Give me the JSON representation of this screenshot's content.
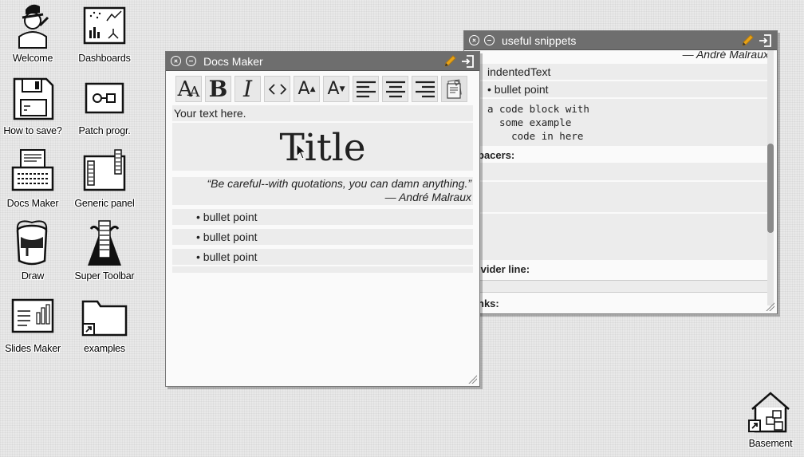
{
  "desktop": {
    "icons": [
      {
        "label": "Welcome",
        "icon": "welcome-person-icon"
      },
      {
        "label": "Dashboards",
        "icon": "dashboards-icon"
      },
      {
        "label": "How to save?",
        "icon": "floppy-disk-icon"
      },
      {
        "label": "Patch progr.",
        "icon": "patch-program-icon"
      },
      {
        "label": "Docs Maker",
        "icon": "typewriter-icon"
      },
      {
        "label": "Generic panel",
        "icon": "generic-panel-icon"
      },
      {
        "label": "Draw",
        "icon": "paint-bucket-icon"
      },
      {
        "label": "Super Toolbar",
        "icon": "super-toolbar-icon"
      },
      {
        "label": "Slides Maker",
        "icon": "slides-icon"
      },
      {
        "label": "examples",
        "icon": "folder-shortcut-icon"
      },
      {
        "label": "Basement",
        "icon": "basement-house-icon"
      }
    ]
  },
  "docs_window": {
    "title": "Docs Maker",
    "toolbar": [
      "font-size-icon",
      "bold-icon",
      "italic-icon",
      "code-icon",
      "increase-size-icon",
      "decrease-size-icon",
      "align-left-icon",
      "align-center-icon",
      "align-right-icon",
      "snippets-icon"
    ],
    "intro_text": "Your text here.",
    "heading": "Title",
    "quote": "“Be careful--with quotations, you can damn anything.”",
    "quote_author": "— André Malraux",
    "bullets": [
      "• bullet point",
      "• bullet point",
      "• bullet point"
    ]
  },
  "snippets_window": {
    "title": "useful snippets",
    "author_partial": "— André Malraux",
    "indented": "indentedText",
    "bullet": "• bullet point",
    "code_lines": [
      "a code block with",
      "  some example",
      "    code in here"
    ],
    "spacers_label": "pacers:",
    "divider_label": "ivider line:",
    "links_label": "nks:"
  },
  "colors": {
    "titlebar": "#6e6e6e",
    "accent_pencil": "#e8a317"
  }
}
